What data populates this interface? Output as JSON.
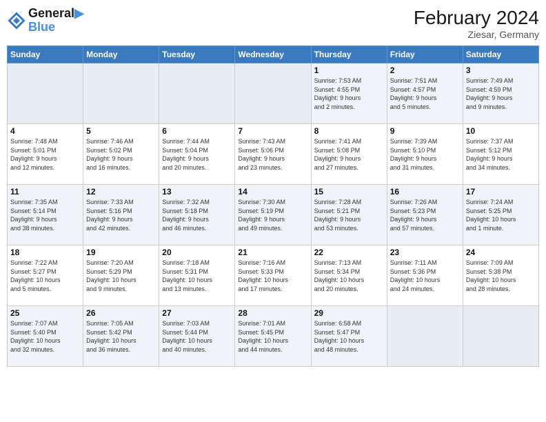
{
  "header": {
    "logo_line1": "General",
    "logo_line2": "Blue",
    "month_year": "February 2024",
    "location": "Ziesar, Germany"
  },
  "days_of_week": [
    "Sunday",
    "Monday",
    "Tuesday",
    "Wednesday",
    "Thursday",
    "Friday",
    "Saturday"
  ],
  "weeks": [
    [
      {
        "day": "",
        "info": ""
      },
      {
        "day": "",
        "info": ""
      },
      {
        "day": "",
        "info": ""
      },
      {
        "day": "",
        "info": ""
      },
      {
        "day": "1",
        "info": "Sunrise: 7:53 AM\nSunset: 4:55 PM\nDaylight: 9 hours\nand 2 minutes."
      },
      {
        "day": "2",
        "info": "Sunrise: 7:51 AM\nSunset: 4:57 PM\nDaylight: 9 hours\nand 5 minutes."
      },
      {
        "day": "3",
        "info": "Sunrise: 7:49 AM\nSunset: 4:59 PM\nDaylight: 9 hours\nand 9 minutes."
      }
    ],
    [
      {
        "day": "4",
        "info": "Sunrise: 7:48 AM\nSunset: 5:01 PM\nDaylight: 9 hours\nand 12 minutes."
      },
      {
        "day": "5",
        "info": "Sunrise: 7:46 AM\nSunset: 5:02 PM\nDaylight: 9 hours\nand 16 minutes."
      },
      {
        "day": "6",
        "info": "Sunrise: 7:44 AM\nSunset: 5:04 PM\nDaylight: 9 hours\nand 20 minutes."
      },
      {
        "day": "7",
        "info": "Sunrise: 7:43 AM\nSunset: 5:06 PM\nDaylight: 9 hours\nand 23 minutes."
      },
      {
        "day": "8",
        "info": "Sunrise: 7:41 AM\nSunset: 5:08 PM\nDaylight: 9 hours\nand 27 minutes."
      },
      {
        "day": "9",
        "info": "Sunrise: 7:39 AM\nSunset: 5:10 PM\nDaylight: 9 hours\nand 31 minutes."
      },
      {
        "day": "10",
        "info": "Sunrise: 7:37 AM\nSunset: 5:12 PM\nDaylight: 9 hours\nand 34 minutes."
      }
    ],
    [
      {
        "day": "11",
        "info": "Sunrise: 7:35 AM\nSunset: 5:14 PM\nDaylight: 9 hours\nand 38 minutes."
      },
      {
        "day": "12",
        "info": "Sunrise: 7:33 AM\nSunset: 5:16 PM\nDaylight: 9 hours\nand 42 minutes."
      },
      {
        "day": "13",
        "info": "Sunrise: 7:32 AM\nSunset: 5:18 PM\nDaylight: 9 hours\nand 46 minutes."
      },
      {
        "day": "14",
        "info": "Sunrise: 7:30 AM\nSunset: 5:19 PM\nDaylight: 9 hours\nand 49 minutes."
      },
      {
        "day": "15",
        "info": "Sunrise: 7:28 AM\nSunset: 5:21 PM\nDaylight: 9 hours\nand 53 minutes."
      },
      {
        "day": "16",
        "info": "Sunrise: 7:26 AM\nSunset: 5:23 PM\nDaylight: 9 hours\nand 57 minutes."
      },
      {
        "day": "17",
        "info": "Sunrise: 7:24 AM\nSunset: 5:25 PM\nDaylight: 10 hours\nand 1 minute."
      }
    ],
    [
      {
        "day": "18",
        "info": "Sunrise: 7:22 AM\nSunset: 5:27 PM\nDaylight: 10 hours\nand 5 minutes."
      },
      {
        "day": "19",
        "info": "Sunrise: 7:20 AM\nSunset: 5:29 PM\nDaylight: 10 hours\nand 9 minutes."
      },
      {
        "day": "20",
        "info": "Sunrise: 7:18 AM\nSunset: 5:31 PM\nDaylight: 10 hours\nand 13 minutes."
      },
      {
        "day": "21",
        "info": "Sunrise: 7:16 AM\nSunset: 5:33 PM\nDaylight: 10 hours\nand 17 minutes."
      },
      {
        "day": "22",
        "info": "Sunrise: 7:13 AM\nSunset: 5:34 PM\nDaylight: 10 hours\nand 20 minutes."
      },
      {
        "day": "23",
        "info": "Sunrise: 7:11 AM\nSunset: 5:36 PM\nDaylight: 10 hours\nand 24 minutes."
      },
      {
        "day": "24",
        "info": "Sunrise: 7:09 AM\nSunset: 5:38 PM\nDaylight: 10 hours\nand 28 minutes."
      }
    ],
    [
      {
        "day": "25",
        "info": "Sunrise: 7:07 AM\nSunset: 5:40 PM\nDaylight: 10 hours\nand 32 minutes."
      },
      {
        "day": "26",
        "info": "Sunrise: 7:05 AM\nSunset: 5:42 PM\nDaylight: 10 hours\nand 36 minutes."
      },
      {
        "day": "27",
        "info": "Sunrise: 7:03 AM\nSunset: 5:44 PM\nDaylight: 10 hours\nand 40 minutes."
      },
      {
        "day": "28",
        "info": "Sunrise: 7:01 AM\nSunset: 5:45 PM\nDaylight: 10 hours\nand 44 minutes."
      },
      {
        "day": "29",
        "info": "Sunrise: 6:58 AM\nSunset: 5:47 PM\nDaylight: 10 hours\nand 48 minutes."
      },
      {
        "day": "",
        "info": ""
      },
      {
        "day": "",
        "info": ""
      }
    ]
  ]
}
